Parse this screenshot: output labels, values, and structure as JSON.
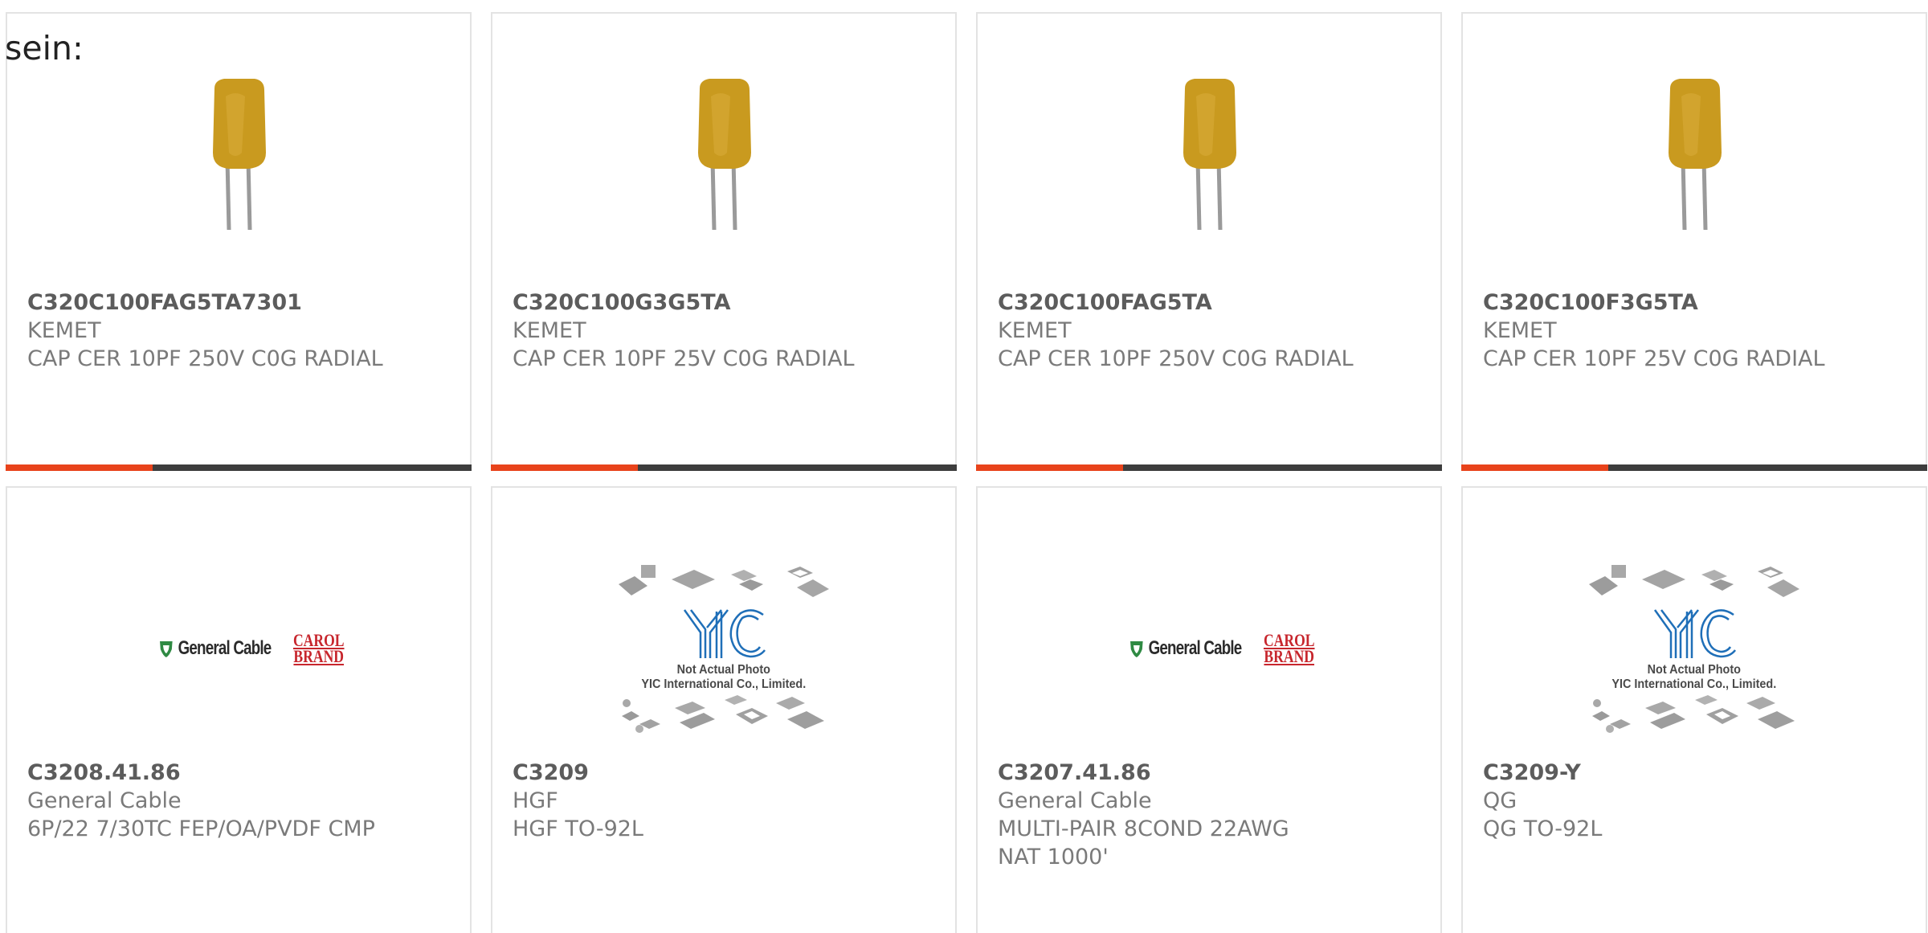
{
  "intro": "sein:",
  "products": [
    {
      "part": "C320C100FAG5TA7301",
      "manufacturer": "KEMET",
      "description": "CAP CER 10PF 250V C0G RADIAL",
      "image": "ceramic-capacitor"
    },
    {
      "part": "C320C100G3G5TA",
      "manufacturer": "KEMET",
      "description": "CAP CER 10PF 25V C0G RADIAL",
      "image": "ceramic-capacitor"
    },
    {
      "part": "C320C100FAG5TA",
      "manufacturer": "KEMET",
      "description": "CAP CER 10PF 250V C0G RADIAL",
      "image": "ceramic-capacitor"
    },
    {
      "part": "C320C100F3G5TA",
      "manufacturer": "KEMET",
      "description": "CAP CER 10PF 25V C0G RADIAL",
      "image": "ceramic-capacitor"
    },
    {
      "part": "C3208.41.86",
      "manufacturer": "General Cable",
      "description": "6P/22 7/30TC FEP/OA/PVDF CMP",
      "image": "general-cable-logo"
    },
    {
      "part": "C3209",
      "manufacturer": "HGF",
      "description": "HGF TO-92L",
      "image": "yic-placeholder"
    },
    {
      "part": "C3207.41.86",
      "manufacturer": "General Cable",
      "description": "MULTI-PAIR 8COND 22AWG NAT 1000'",
      "image": "general-cable-logo"
    },
    {
      "part": "C3209-Y",
      "manufacturer": "QG",
      "description": "QG TO-92L",
      "image": "yic-placeholder"
    }
  ],
  "logos": {
    "general_cable": "General Cable",
    "carol_line1": "CAROL",
    "carol_line2": "BRAND",
    "yic_line1": "Not Actual Photo",
    "yic_line2": "YIC International Co., Limited."
  },
  "colors": {
    "accent": "#e8431b",
    "bar": "#3d3d3d",
    "capacitor": "#c99a1f",
    "general_cable_green": "#2f8a43",
    "carol_red": "#c7262d",
    "yic_blue": "#1f6fb8"
  }
}
